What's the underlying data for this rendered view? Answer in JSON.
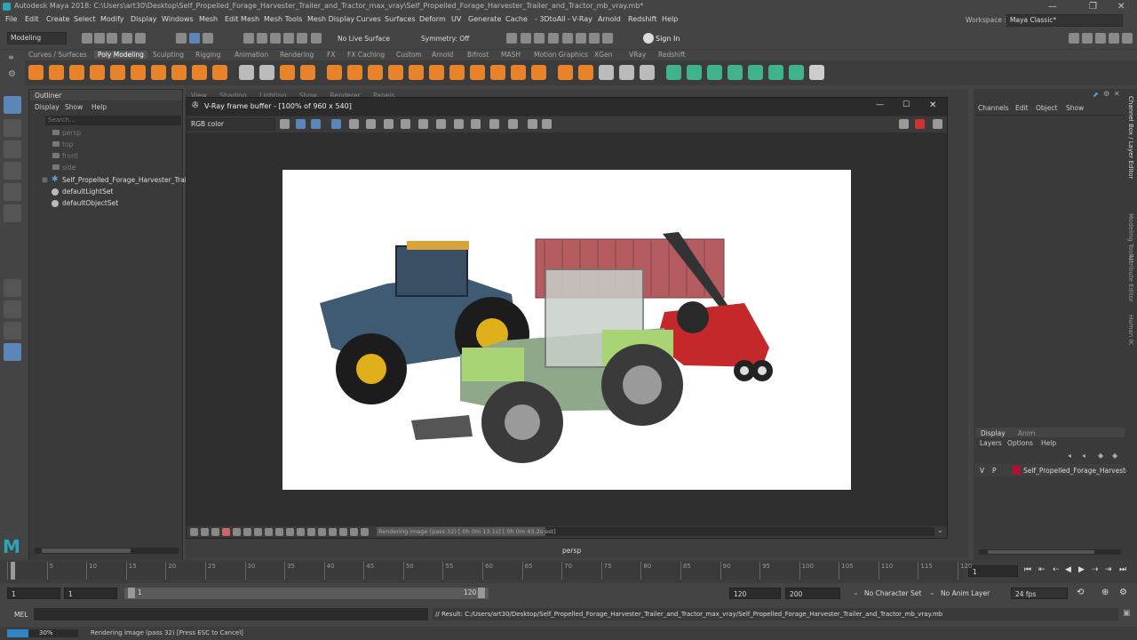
{
  "window": {
    "title": "Autodesk Maya 2018: C:\\Users\\art30\\Desktop\\Self_Propelled_Forage_Harvester_Trailer_and_Tractor_max_vray\\Self_Propelled_Forage_Harvester_Trailer_and_Tractor_mb_vray.mb*",
    "workspace_label": "Workspace :",
    "workspace_value": "Maya Classic*"
  },
  "menu": [
    "File",
    "Edit",
    "Create",
    "Select",
    "Modify",
    "Display",
    "Windows",
    "Mesh",
    "Edit Mesh",
    "Mesh Tools",
    "Mesh Display",
    "Curves",
    "Surfaces",
    "Deform",
    "UV",
    "Generate",
    "Cache",
    "- 3DtoAll -",
    "V-Ray",
    "Arnold",
    "Redshift",
    "Help"
  ],
  "statusline": {
    "mode": "Modeling",
    "live_surface": "No Live Surface",
    "symmetry": "Symmetry: Off",
    "sign_in": "Sign In"
  },
  "shelf_tabs": [
    "Curves / Surfaces",
    "Poly Modeling",
    "Sculpting",
    "Rigging",
    "Animation",
    "Rendering",
    "FX",
    "FX Caching",
    "Custom",
    "Arnold",
    "Bifrost",
    "MASH",
    "Motion Graphics",
    "XGen",
    "VRay",
    "Redshift"
  ],
  "shelf_active": "Poly Modeling",
  "outliner": {
    "title": "Outliner",
    "menu": [
      "Display",
      "Show",
      "Help"
    ],
    "search_placeholder": "Search...",
    "items": [
      "persp",
      "top",
      "front",
      "side",
      "Self_Propelled_Forage_Harvester_Trai",
      "defaultLightSet",
      "defaultObjectSet"
    ]
  },
  "viewport": {
    "menu": [
      "View",
      "Shading",
      "Lighting",
      "Show",
      "Renderer",
      "Panels"
    ],
    "camera": "persp"
  },
  "vfb": {
    "title": "V-Ray frame buffer - [100% of 960 x 540]",
    "channel": "RGB color",
    "status": "Rendering image (pass 32) [ 0h  0m 13.1s] [ 0h  0m 43.2s est]"
  },
  "channel_box": {
    "menu": [
      "Channels",
      "Edit",
      "Object",
      "Show"
    ]
  },
  "layer_editor": {
    "tabs": [
      "Display",
      "Anim"
    ],
    "menu": [
      "Layers",
      "Options",
      "Help"
    ],
    "layer_v": "V",
    "layer_p": "P",
    "layer_name": "Self_Propelled_Forage_Harvester",
    "layer_color": "#b0132f"
  },
  "side_tabs": [
    "Channel Box / Layer Editor",
    "Modeling Toolkit",
    "Attribute Editor",
    "Human IK"
  ],
  "timeline": {
    "ticks": [
      "1",
      "5",
      "10",
      "15",
      "20",
      "25",
      "30",
      "35",
      "40",
      "45",
      "50",
      "55",
      "60",
      "65",
      "70",
      "75",
      "80",
      "85",
      "90",
      "95",
      "100",
      "105",
      "110",
      "115",
      "120"
    ],
    "current_frame": "1"
  },
  "range": {
    "start": "1",
    "playback_start": "1",
    "slider_start": "1",
    "slider_end": "120",
    "playback_end": "120",
    "end": "200",
    "character_set": "No Character Set",
    "anim_layer": "No Anim Layer",
    "fps": "24 fps"
  },
  "mel": {
    "label": "MEL",
    "result": "// Result: C:/Users/art30/Desktop/Self_Propelled_Forage_Harvester_Trailer_and_Tractor_max_vray/Self_Propelled_Forage_Harvester_Trailer_and_Tractor_mb_vray.mb"
  },
  "help": {
    "progress_text": "30%",
    "progress": 0.3,
    "message": "Rendering image (pass 32) [Press ESC to Cancel]"
  }
}
